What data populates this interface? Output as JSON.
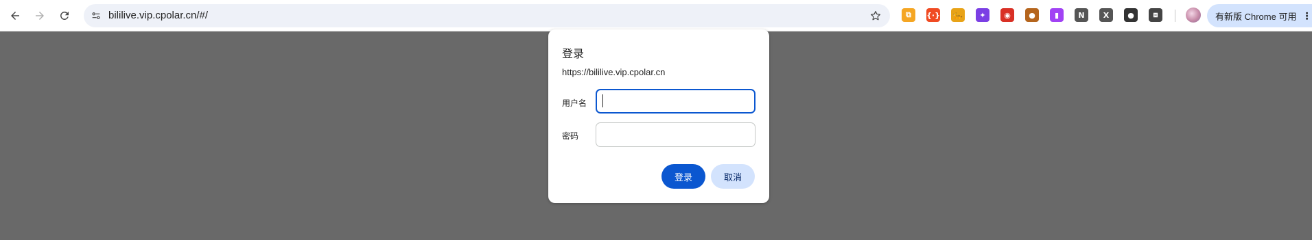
{
  "browser": {
    "url": "bililive.vip.cpolar.cn/#/",
    "update_chip": "有新版 Chrome 可用",
    "update_menu_glyph": "⋮",
    "extensions": [
      {
        "name": "ext-copy",
        "glyph": "⧉",
        "color": "#f5a623"
      },
      {
        "name": "ext-json",
        "glyph": "{·}",
        "color": "#f04b23"
      },
      {
        "name": "ext-cheetah",
        "glyph": "🐆",
        "color": "#e8a317"
      },
      {
        "name": "ext-sparkle",
        "glyph": "✦",
        "color": "#7b3fe4"
      },
      {
        "name": "ext-face",
        "glyph": "◉",
        "color": "#d93025"
      },
      {
        "name": "ext-cookie",
        "glyph": "●",
        "color": "#b5651d"
      },
      {
        "name": "ext-purple",
        "glyph": "▮",
        "color": "#a142f4"
      },
      {
        "name": "ext-notion",
        "glyph": "N",
        "color": "#555555"
      },
      {
        "name": "ext-x",
        "glyph": "X",
        "color": "#555555"
      },
      {
        "name": "ext-user",
        "glyph": "●",
        "color": "#333333"
      },
      {
        "name": "ext-puzzle",
        "glyph": "⧈",
        "color": "#444444"
      }
    ]
  },
  "dialog": {
    "title": "登录",
    "origin": "https://bililive.vip.cpolar.cn",
    "username_label": "用户名",
    "username_value": "",
    "password_label": "密码",
    "password_value": "",
    "login_button": "登录",
    "cancel_button": "取消"
  },
  "colors": {
    "backdrop": "#696969",
    "primary": "#0b57d0",
    "secondary": "#d3e3fd"
  }
}
